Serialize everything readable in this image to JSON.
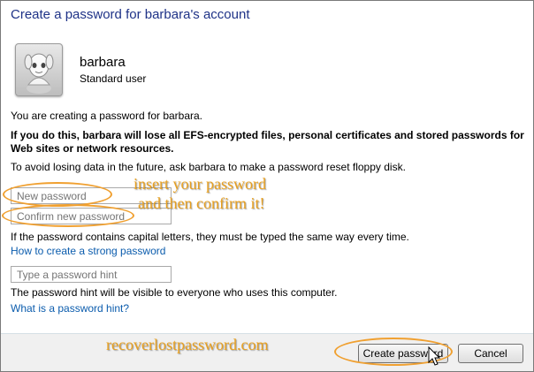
{
  "window": {
    "title": "Create a password for barbara's account"
  },
  "user": {
    "name": "barbara",
    "role": "Standard user",
    "avatar_icon": "user-avatar-icon"
  },
  "content": {
    "intro": "You are creating a password for barbara.",
    "warning_line1": "If you do this, barbara will lose all EFS-encrypted files, personal certificates and stored passwords for",
    "warning_line2": "Web sites or network resources.",
    "advice": "To avoid losing data in the future, ask barbara to make a password reset floppy disk.",
    "caps_note": "If the password contains capital letters, they must be typed the same way every time.",
    "strong_link": "How to create a strong password",
    "hint_note": "The password hint will be visible to everyone who uses this computer.",
    "hint_link": "What is a password hint?"
  },
  "form": {
    "new_password_placeholder": "New password",
    "confirm_password_placeholder": "Confirm new password",
    "hint_placeholder": "Type a password hint"
  },
  "annotations": {
    "line1": "insert your password",
    "line2": "and then confirm it!",
    "watermark": "recoverlostpassword.com",
    "color": "#e8a020"
  },
  "buttons": {
    "create": "Create password",
    "cancel": "Cancel"
  }
}
